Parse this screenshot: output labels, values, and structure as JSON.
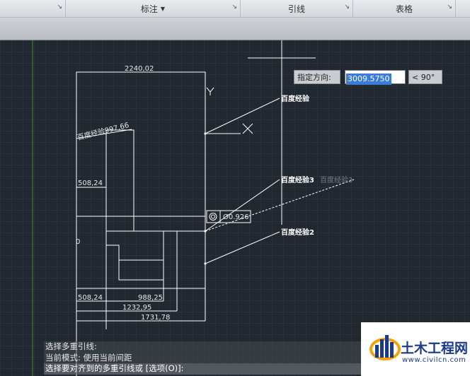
{
  "ribbon": {
    "panels": [
      {
        "label": ""
      },
      {
        "label": "标注",
        "has_dropdown": true
      },
      {
        "label": "引线"
      },
      {
        "label": "表格"
      }
    ]
  },
  "drawing": {
    "dimensions": {
      "top_width": "2240,02",
      "rotated": "百度经验997,66",
      "left_width": "508,24",
      "bottom_left": "508,24",
      "bottom_1": "988,25",
      "bottom_2": "1232,95",
      "bottom_3": "1731,78",
      "side_fragment": "0"
    },
    "leaders": {
      "leader_1": "百度经验",
      "leader_3": "百度经验3",
      "leader_3_ghost": "百度经验3",
      "leader_2": "百度经验2"
    },
    "tolerance": {
      "symbol": "⌖",
      "value": "Ø0.926"
    },
    "ucs": {
      "y_label": "Y"
    }
  },
  "dynamic_input": {
    "label": "指定方向:",
    "value": "3009.5750",
    "angle": "< 90°"
  },
  "command_line": [
    "选择多重引线:",
    "当前模式:  使用当前间距",
    "选择要对齐到的多重引线或 [选项(O)]:"
  ],
  "watermark": {
    "title": "土木工程网",
    "url": "www.civilcn.com"
  },
  "colors": {
    "canvas_bg": "#212830",
    "line": "#ffffff",
    "highlight": "#3b7bd9",
    "logo_blue": "#1a3a8c"
  }
}
